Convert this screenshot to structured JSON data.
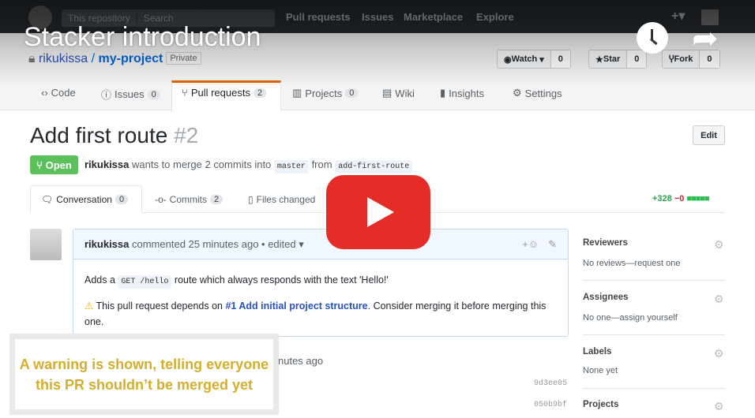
{
  "video": {
    "title": "Stacker introduction",
    "caption": "A warning is shown, telling everyone this PR shouldn’t be merged yet",
    "play_color": "#e52d27"
  },
  "topbar": {
    "search_scope": "This repository",
    "search_placeholder": "Search",
    "nav": [
      "Pull requests",
      "Issues",
      "Marketplace",
      "Explore"
    ]
  },
  "repo": {
    "owner": "rikukissa",
    "name": "my-project",
    "visibility": "Private",
    "watch": "Watch",
    "watch_count": "0",
    "star": "Star",
    "star_count": "0",
    "fork": "Fork",
    "fork_count": "0"
  },
  "tabs": [
    {
      "label": "Code"
    },
    {
      "label": "Issues",
      "count": "0"
    },
    {
      "label": "Pull requests",
      "count": "2"
    },
    {
      "label": "Projects",
      "count": "0"
    },
    {
      "label": "Wiki"
    },
    {
      "label": "Insights"
    },
    {
      "label": "Settings"
    }
  ],
  "pr": {
    "title": "Add first route",
    "number": "#2",
    "edit": "Edit",
    "state": "Open",
    "author": "rikukissa",
    "meta": "wants to merge 2 commits into",
    "base": "master",
    "from": "from",
    "head": "add-first-route"
  },
  "pr_tabs": [
    {
      "label": "Conversation",
      "count": "0"
    },
    {
      "label": "Commits",
      "count": "2"
    },
    {
      "label": "Files changed"
    }
  ],
  "diffstat": {
    "add": "+328",
    "del": "−0"
  },
  "comment": {
    "author": "rikukissa",
    "meta": "commented 25 minutes ago • edited",
    "body_pre": "Adds a",
    "body_code": "GET /hello",
    "body_post": "route which always responds with the text 'Hello!'",
    "warn_pre": "This pull request depends on",
    "warn_link": "#1 Add initial project structure",
    "warn_post": ". Consider merging it before merging this one."
  },
  "timeline": {
    "partial": "nutes ago",
    "shas": [
      "9d3ee05",
      "050b9bf"
    ]
  },
  "sidebar": [
    {
      "title": "Reviewers",
      "text": "No reviews—request one"
    },
    {
      "title": "Assignees",
      "text": "No one—assign yourself"
    },
    {
      "title": "Labels",
      "text": "None yet"
    },
    {
      "title": "Projects",
      "text": ""
    }
  ]
}
